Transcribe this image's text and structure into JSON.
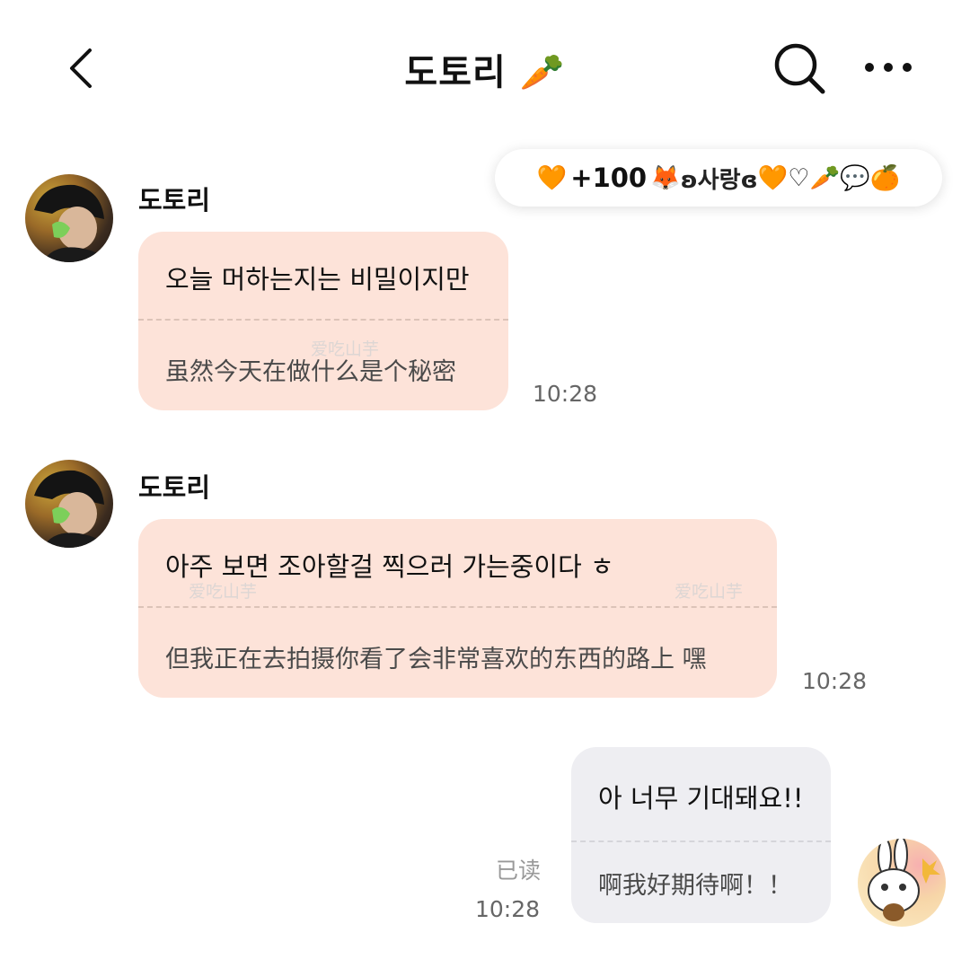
{
  "header": {
    "title": "도토리",
    "title_emoji": "🥕"
  },
  "status_pill": {
    "heart": "🧡",
    "points": "+100",
    "fox": "🦊",
    "love_text": "ʚ사랑ɞ",
    "heart2": "🧡",
    "outline_heart": "♡",
    "carrot": "🥕",
    "speech": "💬",
    "orange": "🍊"
  },
  "messages": [
    {
      "sender": "도토리",
      "text_kr": "오늘 머하는지는 비밀이지만",
      "text_cn": "虽然今天在做什么是个秘密",
      "time": "10:28"
    },
    {
      "sender": "도토리",
      "text_kr": "아주 보면 조아할걸 찍으러 가는중이다 ㅎ",
      "text_cn": "但我正在去拍摄你看了会非常喜欢的东西的路上 嘿",
      "time": "10:28"
    },
    {
      "text_kr": "아 너무 기대돼요!!",
      "text_cn": "啊我好期待啊！！",
      "read_label": "已读",
      "time": "10:28"
    }
  ],
  "watermark": "爱吃山芋",
  "colors": {
    "incoming_bubble": "#fde3d9",
    "outgoing_bubble": "#eeeef2",
    "background": "#ffffff"
  },
  "icons": [
    "back-chevron-icon",
    "search-icon",
    "more-dots-icon"
  ]
}
